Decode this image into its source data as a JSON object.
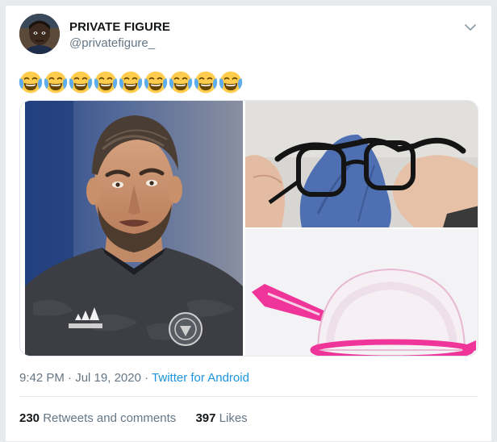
{
  "tweet": {
    "author": {
      "display_name": "PRIVATE FIGURE",
      "handle": "@privatefigure_"
    },
    "text_emoji": "😂😂😂😂😂😂😂😂😂",
    "emoji_count": 9,
    "emoji_name": "face-with-tears-of-joy",
    "media": {
      "count": 3,
      "images": [
        {
          "position": "left",
          "subject": "goalkeeper in dark jersey"
        },
        {
          "position": "top-right",
          "subject": "cleaning glasses with cloth"
        },
        {
          "position": "bottom-right",
          "subject": "pink mesh strainer"
        }
      ]
    },
    "meta": {
      "time": "9:42 PM",
      "date": "Jul 19, 2020",
      "separator": "·",
      "source": "Twitter for Android"
    },
    "stats": {
      "retweets_count": "230",
      "retweets_label": "Retweets and comments",
      "likes_count": "397",
      "likes_label": "Likes"
    }
  },
  "colors": {
    "link": "#1b95e0",
    "secondary_text": "#657786",
    "primary_text": "#14171a",
    "divider": "#e6ecf0"
  }
}
